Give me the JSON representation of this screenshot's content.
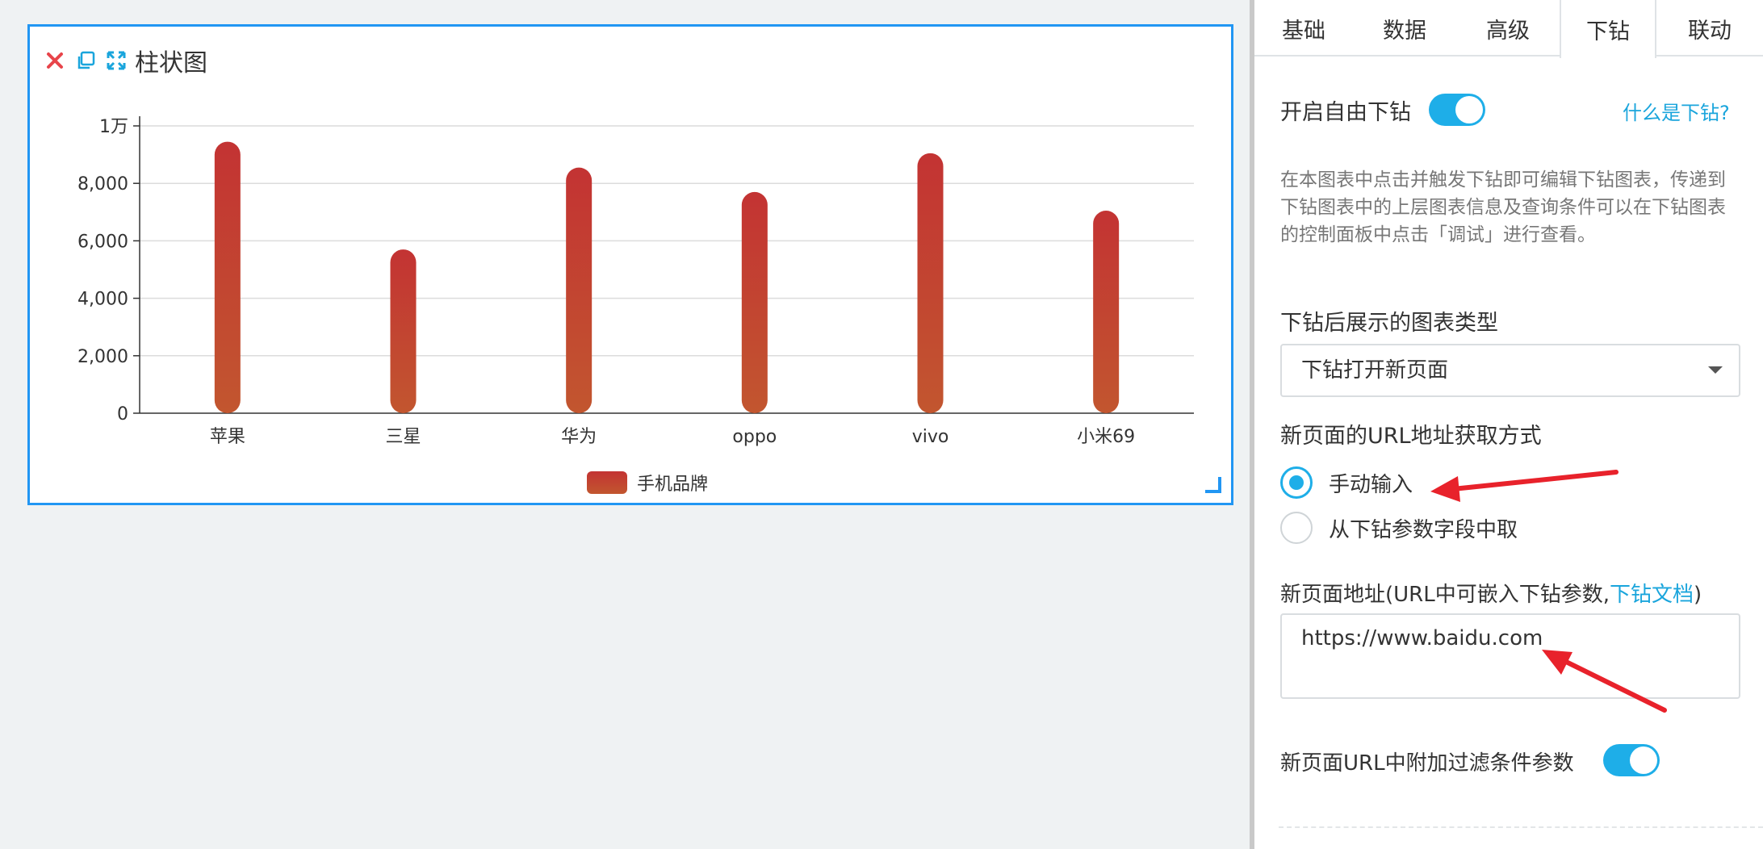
{
  "card": {
    "title": "柱状图"
  },
  "chart_data": {
    "type": "bar",
    "categories": [
      "苹果",
      "三星",
      "华为",
      "oppo",
      "vivo",
      "小米69"
    ],
    "series": [
      {
        "name": "手机品牌",
        "values": [
          9450,
          5700,
          8550,
          7700,
          9050,
          7050
        ]
      }
    ],
    "y_ticks": [
      "0",
      "2,000",
      "4,000",
      "6,000",
      "8,000",
      "1万"
    ],
    "ylim": [
      0,
      10000
    ],
    "grid": true,
    "legend_position": "bottom-center",
    "bar_colors": {
      "top": "#c33333",
      "bottom": "#c2562f"
    }
  },
  "tabs": [
    "基础",
    "数据",
    "高级",
    "下钻",
    "联动"
  ],
  "active_tab": "下钻",
  "drill": {
    "enable_label": "开启自由下钻",
    "enable_on": true,
    "help_link": "什么是下钻?",
    "description": "在本图表中点击并触发下钻即可编辑下钻图表，传递到下钻图表中的上层图表信息及查询条件可以在下钻图表的控制面板中点击「调试」进行查看。",
    "chart_type_label": "下钻后展示的图表类型",
    "chart_type_value": "下钻打开新页面",
    "url_method_label": "新页面的URL地址获取方式",
    "url_methods": [
      "手动输入",
      "从下钻参数字段中取"
    ],
    "url_method_selected": 0,
    "url_label_prefix": "新页面地址(URL中可嵌入下钻参数,",
    "url_label_link": "下钻文档",
    "url_label_suffix": ")",
    "url_value": "https://www.baidu.com",
    "filter_param_label": "新页面URL中附加过滤条件参数",
    "filter_param_on": true
  },
  "colors": {
    "accent": "#1eaee8",
    "card_border": "#2196f3",
    "annotation_arrow": "#e8222b"
  }
}
